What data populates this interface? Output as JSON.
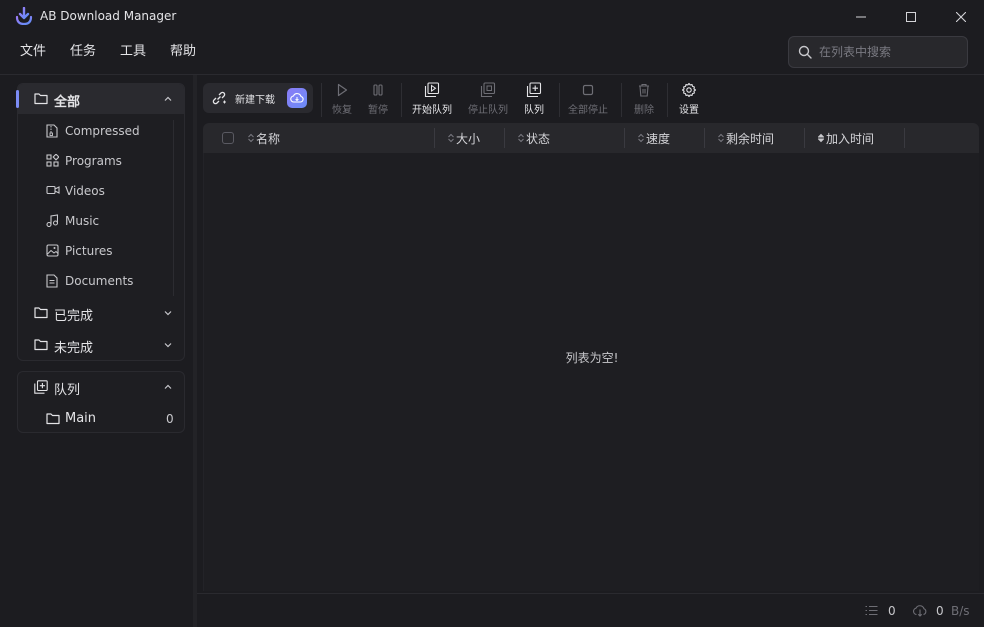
{
  "app": {
    "title": "AB Download Manager"
  },
  "menu": [
    "文件",
    "任务",
    "工具",
    "帮助"
  ],
  "search": {
    "placeholder": "在列表中搜索"
  },
  "sidebar": {
    "all": {
      "label": "全部",
      "expanded": true,
      "icon": "folder-icon"
    },
    "categories": [
      {
        "label": "Compressed",
        "icon": "archive-file-icon"
      },
      {
        "label": "Programs",
        "icon": "apps-grid-icon"
      },
      {
        "label": "Videos",
        "icon": "video-camera-icon"
      },
      {
        "label": "Music",
        "icon": "music-note-icon"
      },
      {
        "label": "Pictures",
        "icon": "image-icon"
      },
      {
        "label": "Documents",
        "icon": "document-icon"
      }
    ],
    "finished": {
      "label": "已完成",
      "icon": "folder-icon"
    },
    "unfinished": {
      "label": "未完成",
      "icon": "folder-icon"
    },
    "queues": {
      "label": "队列",
      "icon": "queue-icon",
      "items": [
        {
          "label": "Main",
          "count": "0",
          "icon": "folder-icon"
        }
      ]
    }
  },
  "toolbar": {
    "new_download": "新建下载",
    "buttons": [
      {
        "label": "恢复",
        "icon": "play-icon",
        "enabled": false
      },
      {
        "label": "暂停",
        "icon": "pause-icon",
        "enabled": false
      },
      {
        "label": "开始队列",
        "icon": "start-queue-icon",
        "enabled": true
      },
      {
        "label": "停止队列",
        "icon": "stop-queue-icon",
        "enabled": false
      },
      {
        "label": "队列",
        "icon": "queue-icon",
        "enabled": true
      },
      {
        "label": "全部停止",
        "icon": "stop-icon",
        "enabled": false
      },
      {
        "label": "删除",
        "icon": "trash-icon",
        "enabled": false
      },
      {
        "label": "设置",
        "icon": "gear-icon",
        "enabled": true
      }
    ]
  },
  "table": {
    "columns": [
      "名称",
      "大小",
      "状态",
      "速度",
      "剩余时间",
      "加入时间"
    ],
    "empty_message": "列表为空!"
  },
  "status": {
    "active_count": "0",
    "speed_value": "0",
    "speed_unit": "B/s"
  },
  "colors": {
    "accent": "#7c8cf5",
    "background": "#1c1c20",
    "panel": "#28282c"
  }
}
